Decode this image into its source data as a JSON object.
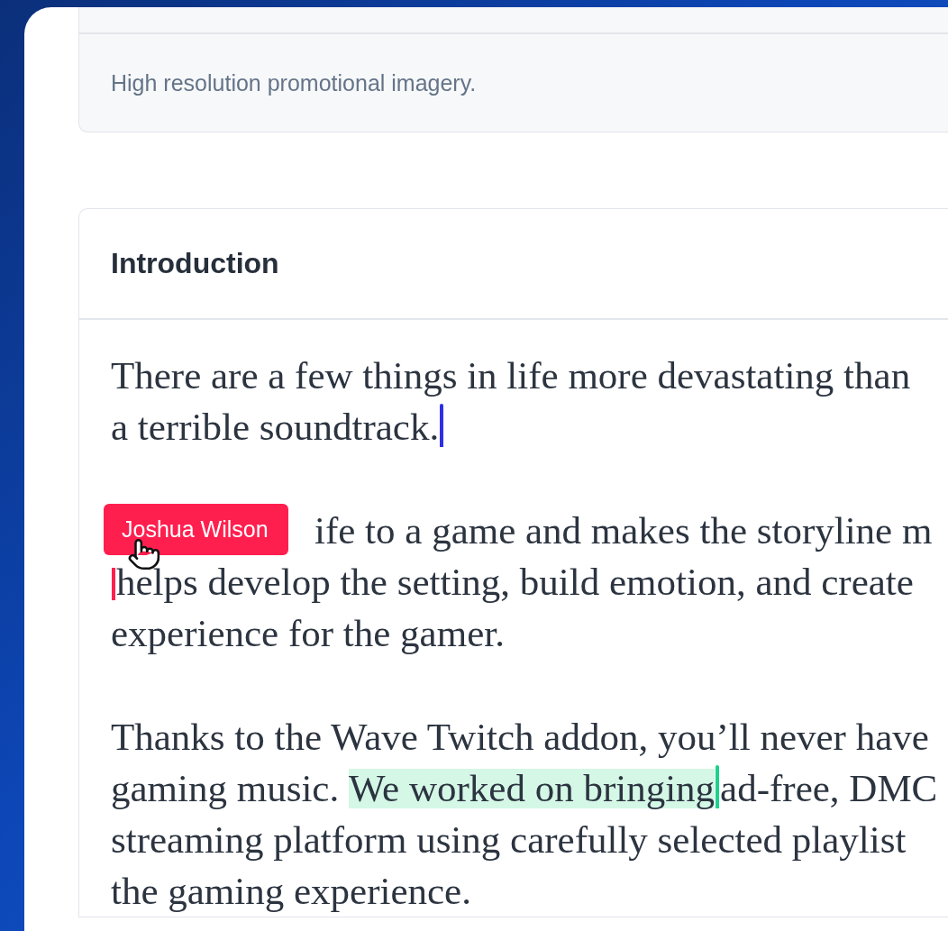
{
  "asset_box": {
    "description": "High resolution promotional imagery."
  },
  "section": {
    "title": "Introduction",
    "paragraphs": [
      {
        "lines": [
          {
            "segments": [
              {
                "kind": "text",
                "text": "There are a few things in life more devastating than",
                "highlighted": false
              }
            ]
          },
          {
            "segments": [
              {
                "kind": "text",
                "text": "a terrible soundtrack.",
                "highlighted": false,
                "cursor_after": {
                  "color": "#2f2fe6"
                }
              }
            ]
          }
        ]
      },
      {
        "lines": [
          {
            "segments": [
              {
                "kind": "covered"
              },
              {
                "kind": "text",
                "text": "ife to a game and makes the storyline m",
                "highlighted": false
              }
            ]
          },
          {
            "segments": [
              {
                "kind": "text",
                "text": "helps develop the setting, build emotion, and create",
                "highlighted": false,
                "cursor_before": {
                  "color": "#ff1f4f",
                  "name": "Joshua Wilson"
                }
              }
            ]
          },
          {
            "segments": [
              {
                "kind": "text",
                "text": "experience for the gamer.",
                "highlighted": false
              }
            ]
          }
        ]
      },
      {
        "lines": [
          {
            "segments": [
              {
                "kind": "text",
                "text": "Thanks to the Wave Twitch addon, you’ll never have",
                "highlighted": false
              }
            ]
          },
          {
            "segments": [
              {
                "kind": "text",
                "text": "gaming music. ",
                "highlighted": false
              },
              {
                "kind": "text",
                "text": "We worked on bringing",
                "highlighted": true,
                "cursor_after": {
                  "color": "#19d38a"
                }
              },
              {
                "kind": "text",
                "text": "ad-free, DMC",
                "highlighted": false
              }
            ]
          },
          {
            "segments": [
              {
                "kind": "text",
                "text": "streaming platform using carefully selected playlist",
                "highlighted": false
              }
            ]
          },
          {
            "segments": [
              {
                "kind": "text",
                "text": "the gaming experience.",
                "highlighted": false
              }
            ]
          }
        ]
      }
    ]
  }
}
